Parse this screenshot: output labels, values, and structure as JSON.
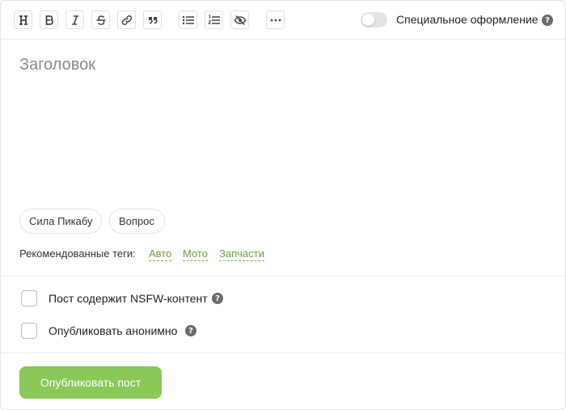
{
  "toolbar": {
    "buttons": [
      {
        "name": "heading",
        "icon": "heading-icon"
      },
      {
        "name": "bold",
        "icon": "bold-icon"
      },
      {
        "name": "italic",
        "icon": "italic-icon"
      },
      {
        "name": "strikethrough",
        "icon": "strikethrough-icon"
      },
      {
        "name": "link",
        "icon": "link-icon"
      },
      {
        "name": "quote",
        "icon": "quote-icon"
      },
      {
        "name": "bullet-list",
        "icon": "bullet-list-icon"
      },
      {
        "name": "numbered-list",
        "icon": "numbered-list-icon"
      },
      {
        "name": "hidden-text",
        "icon": "eye-crossed-icon"
      },
      {
        "name": "more",
        "icon": "more-dots-icon"
      }
    ],
    "special_toggle": {
      "label": "Специальное оформление",
      "on": false
    }
  },
  "editor": {
    "title_placeholder": "Заголовок",
    "title_value": ""
  },
  "chips": [
    "Сила Пикабу",
    "Вопрос"
  ],
  "recommended": {
    "label": "Рекомендованные теги:",
    "tags": [
      "Авто",
      "Мото",
      "Запчасти"
    ]
  },
  "options": {
    "nsfw": {
      "label": "Пост содержит NSFW-контент",
      "checked": false
    },
    "anonymous": {
      "label": "Опубликовать анонимно",
      "checked": false
    }
  },
  "publish_label": "Опубликовать пост",
  "colors": {
    "accent_green": "#8ac858",
    "tag_green": "#67a33b",
    "help_icon": "#6b6b6b"
  }
}
